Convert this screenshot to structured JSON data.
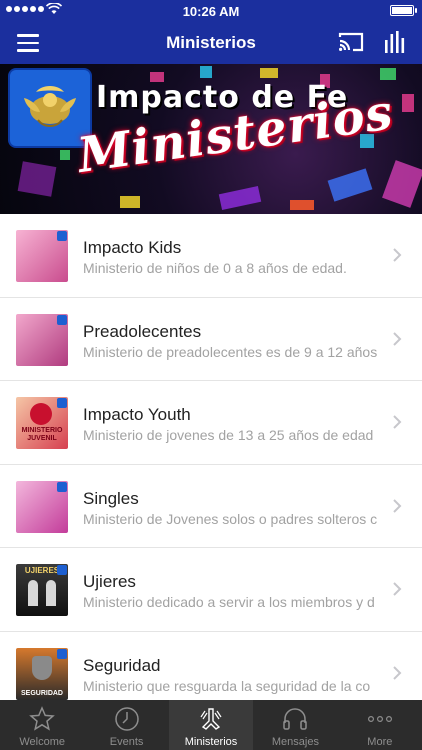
{
  "status_bar": {
    "time": "10:26 AM"
  },
  "nav": {
    "title": "Ministerios"
  },
  "banner": {
    "brand": "Impacto de Fe",
    "script": "Ministerios"
  },
  "list": [
    {
      "name": "Impacto Kids",
      "desc": "Ministerio de niños de 0 a 8 años de edad.",
      "thumb_colors": [
        "#f7b3d3",
        "#c94c8e"
      ]
    },
    {
      "name": "Preadolecentes",
      "desc": "Ministerio de preadolecentes es de 9 a 12 años",
      "thumb_colors": [
        "#f2a8cc",
        "#b03b7f"
      ]
    },
    {
      "name": "Impacto Youth",
      "desc": "Ministerio de jovenes de 13 a 25 años de edad",
      "thumb_colors": [
        "#f5c6a6",
        "#d64050"
      ],
      "thumb_text": [
        "MINISTERIO",
        "JUVENIL"
      ]
    },
    {
      "name": "Singles",
      "desc": "Ministerio de Jovenes solos o padres solteros c",
      "thumb_colors": [
        "#f3b7dc",
        "#c33c9a"
      ]
    },
    {
      "name": "Ujieres",
      "desc": "Ministerio dedicado a servir a los miembros y d",
      "thumb_colors": [
        "#3b3b3b",
        "#101010"
      ],
      "thumb_text": [
        "UJIERES"
      ]
    },
    {
      "name": "Seguridad",
      "desc": "Ministerio que resguarda la seguridad de la co",
      "thumb_colors": [
        "#d6792d",
        "#2a2a2a"
      ],
      "thumb_text": [
        "SEGURIDAD"
      ]
    }
  ],
  "tabs": [
    {
      "label": "Welcome",
      "icon": "star-icon"
    },
    {
      "label": "Events",
      "icon": "clock-icon"
    },
    {
      "label": "Ministerios",
      "icon": "praying-hands-icon",
      "active": true
    },
    {
      "label": "Mensajes",
      "icon": "headphones-icon"
    },
    {
      "label": "More",
      "icon": "more-dots-icon"
    }
  ],
  "colors": {
    "nav_bg": "#1b2f9e",
    "tabbar_bg": "#2c2c2c",
    "accent_red": "#e0002a"
  }
}
